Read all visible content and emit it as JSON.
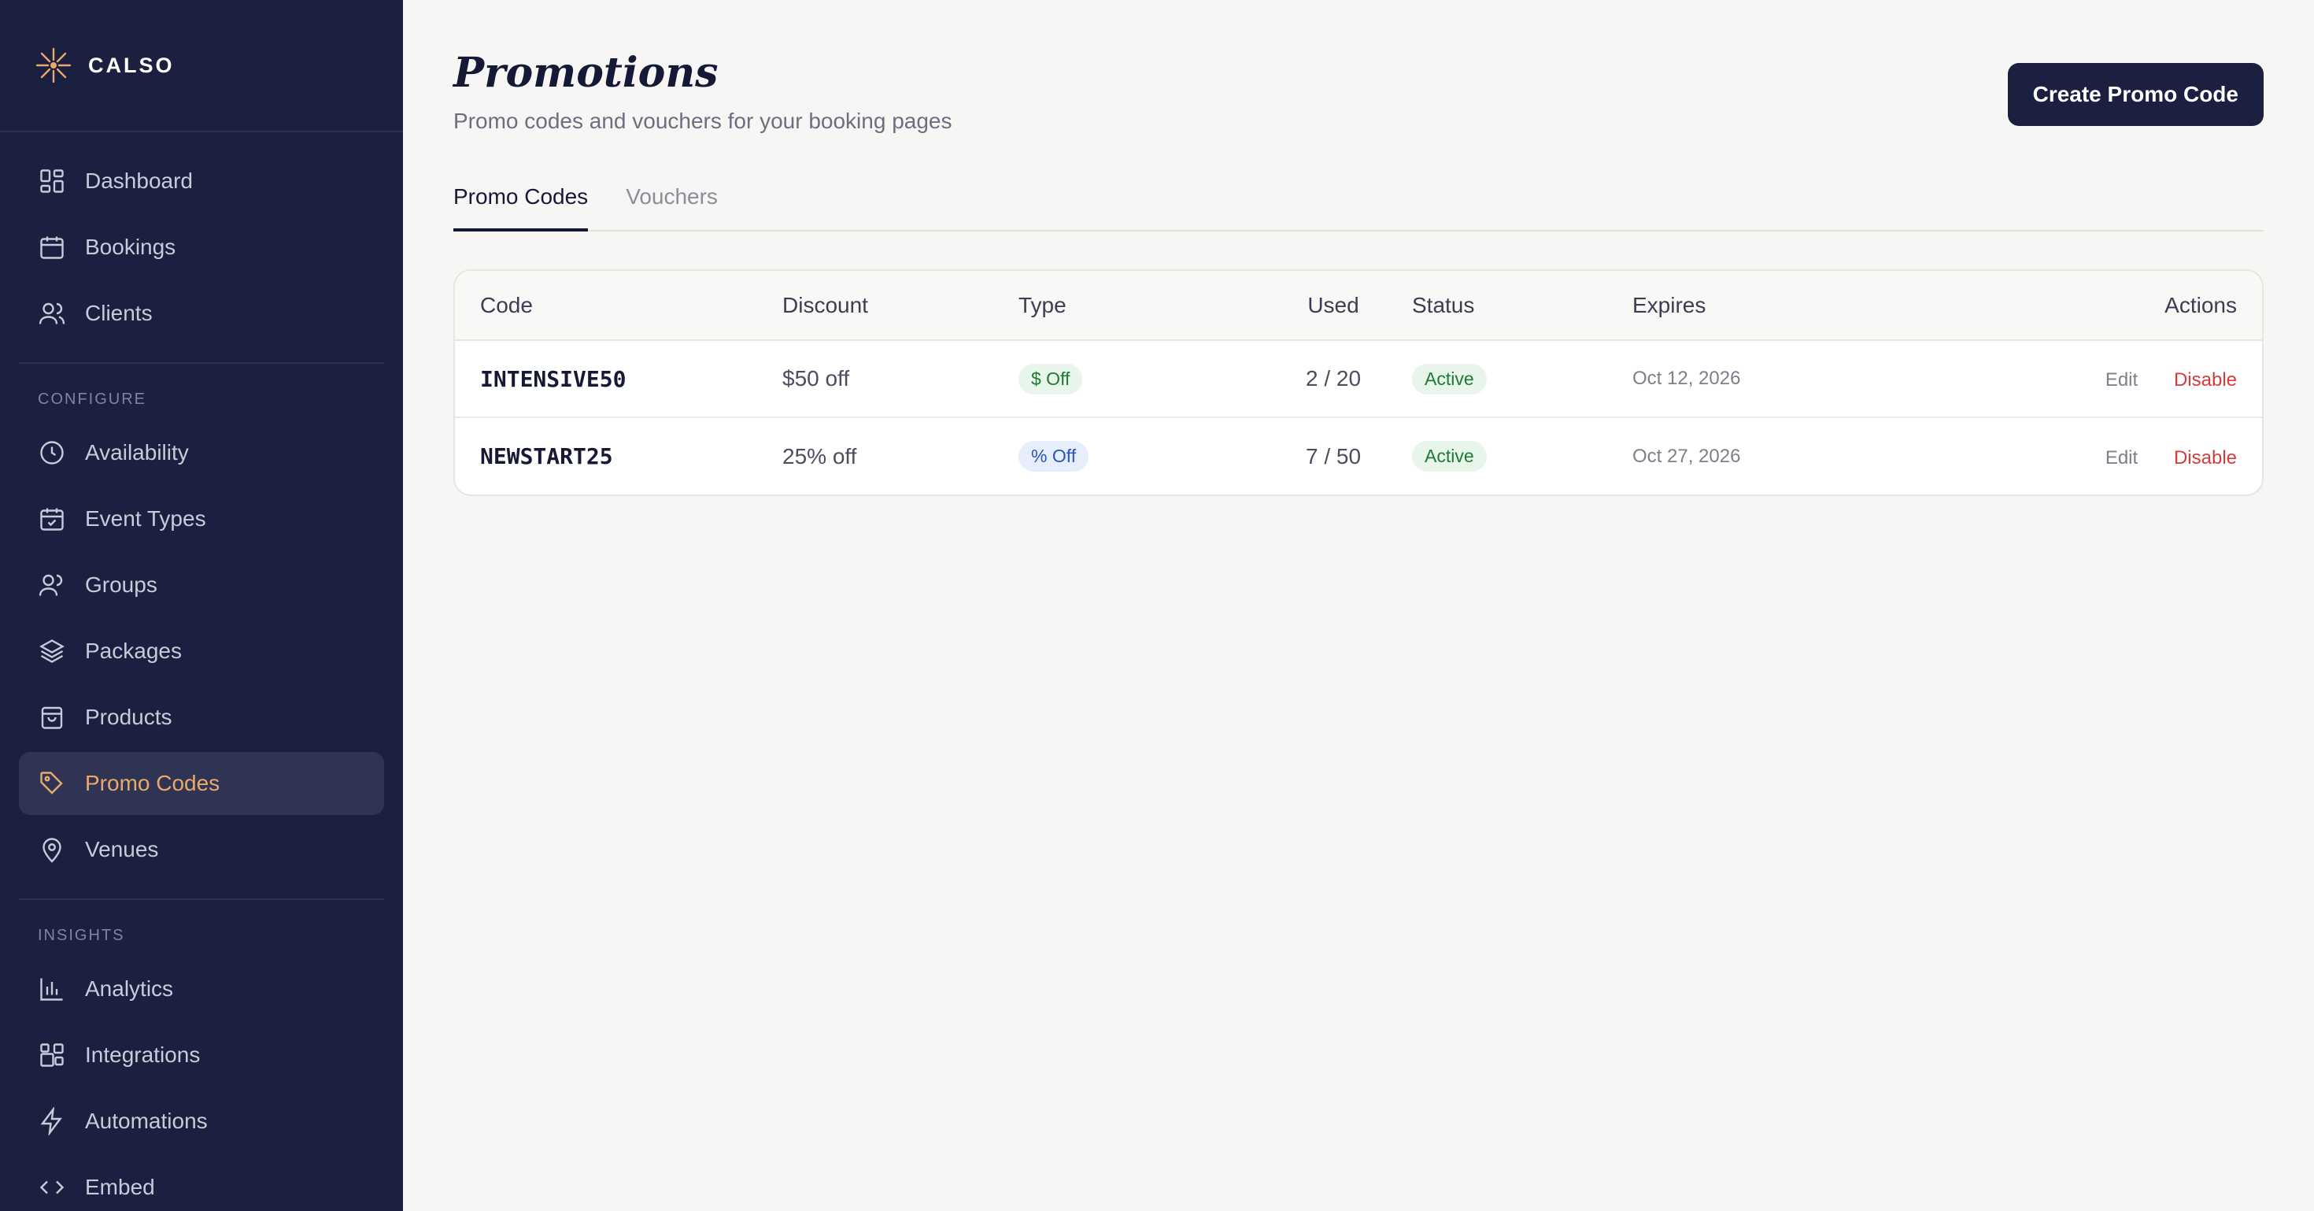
{
  "brand": {
    "name": "CALSO",
    "accent": "#e8a96a"
  },
  "sidebar": {
    "main_items": [
      {
        "label": "Dashboard",
        "icon": "dashboard-icon"
      },
      {
        "label": "Bookings",
        "icon": "calendar-icon"
      },
      {
        "label": "Clients",
        "icon": "users-icon"
      }
    ],
    "configure_heading": "CONFIGURE",
    "configure_items": [
      {
        "label": "Availability",
        "icon": "clock-icon"
      },
      {
        "label": "Event Types",
        "icon": "calendar-check-icon"
      },
      {
        "label": "Groups",
        "icon": "group-icon"
      },
      {
        "label": "Packages",
        "icon": "layers-icon"
      },
      {
        "label": "Products",
        "icon": "bag-icon"
      },
      {
        "label": "Promo Codes",
        "icon": "tag-icon",
        "active": true
      },
      {
        "label": "Venues",
        "icon": "map-pin-icon"
      }
    ],
    "insights_heading": "INSIGHTS",
    "insights_items": [
      {
        "label": "Analytics",
        "icon": "bar-chart-icon"
      },
      {
        "label": "Integrations",
        "icon": "puzzle-icon"
      },
      {
        "label": "Automations",
        "icon": "bolt-icon"
      },
      {
        "label": "Embed",
        "icon": "code-icon"
      }
    ]
  },
  "header": {
    "title": "Promotions",
    "subtitle": "Promo codes and vouchers for your booking pages",
    "create_label": "Create Promo Code"
  },
  "tabs": [
    {
      "label": "Promo Codes",
      "active": true
    },
    {
      "label": "Vouchers",
      "active": false
    }
  ],
  "table": {
    "columns": [
      "Code",
      "Discount",
      "Type",
      "Used",
      "Status",
      "Expires",
      "Actions"
    ],
    "rows": [
      {
        "code": "INTENSIVE50",
        "discount": "$50 off",
        "type": "$ Off",
        "type_color": "green",
        "used": "2 / 20",
        "status": "Active",
        "expires": "Oct 12, 2026",
        "edit": "Edit",
        "disable": "Disable"
      },
      {
        "code": "NEWSTART25",
        "discount": "25% off",
        "type": "% Off",
        "type_color": "blue",
        "used": "7 / 50",
        "status": "Active",
        "expires": "Oct 27, 2026",
        "edit": "Edit",
        "disable": "Disable"
      }
    ]
  }
}
